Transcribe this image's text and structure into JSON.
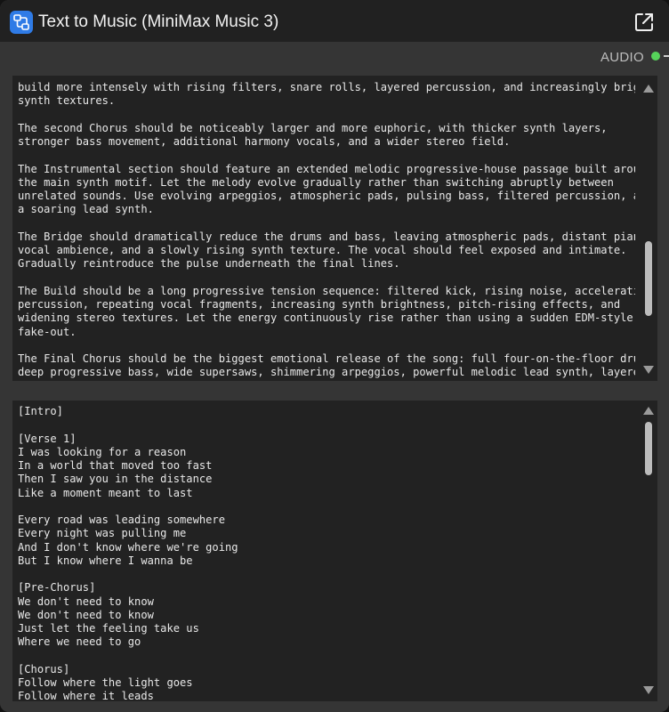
{
  "node": {
    "title": "Text to Music (MiniMax Music 3)",
    "app_icon": "node-graph-icon",
    "expand_icon": "open-external-icon",
    "accent_color": "#2f7be6"
  },
  "output": {
    "label": "AUDIO",
    "dot_color": "#56d35a"
  },
  "prompt_field": {
    "text": "build more intensely with rising filters, snare rolls, layered percussion, and increasingly bright\nsynth textures.\n\nThe second Chorus should be noticeably larger and more euphoric, with thicker synth layers,\nstronger bass movement, additional harmony vocals, and a wider stereo field.\n\nThe Instrumental section should feature an extended melodic progressive-house passage built around\nthe main synth motif. Let the melody evolve gradually rather than switching abruptly between\nunrelated sounds. Use evolving arpeggios, atmospheric pads, pulsing bass, filtered percussion, and\na soaring lead synth.\n\nThe Bridge should dramatically reduce the drums and bass, leaving atmospheric pads, distant piano,\nvocal ambience, and a slowly rising synth texture. The vocal should feel exposed and intimate.\nGradually reintroduce the pulse underneath the final lines.\n\nThe Build should be a long progressive tension sequence: filtered kick, rising noise, accelerating\npercussion, repeating vocal fragments, increasing synth brightness, pitch-rising effects, and\nwidening stereo textures. Let the energy continuously rise rather than using a sudden EDM-style\nfake-out.\n\nThe Final Chorus should be the biggest emotional release of the song: full four-on-the-floor drums,\ndeep progressive bass, wide supersaws, shimmering arpeggios, powerful melodic lead synth, layered"
  },
  "lyrics_field": {
    "text": "[Intro]\n\n[Verse 1]\nI was looking for a reason\nIn a world that moved too fast\nThen I saw you in the distance\nLike a moment meant to last\n\nEvery road was leading somewhere\nEvery night was pulling me\nAnd I don't know where we're going\nBut I know where I wanna be\n\n[Pre-Chorus]\nWe don't need to know\nWe don't need to know\nJust let the feeling take us\nWhere we need to go\n\n[Chorus]\nFollow where the light goes\nFollow where it leads"
  }
}
